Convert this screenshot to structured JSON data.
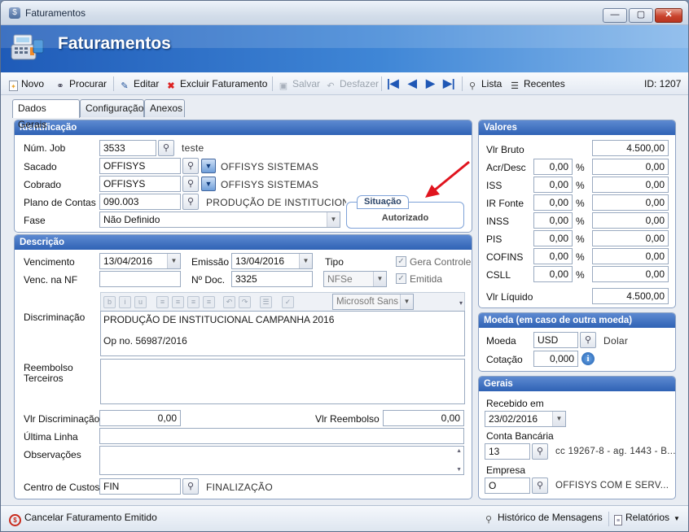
{
  "window": {
    "title": "Faturamentos",
    "banner_title": "Faturamentos"
  },
  "toolbar": {
    "novo": "Novo",
    "procurar": "Procurar",
    "editar": "Editar",
    "excluir": "Excluir Faturamento",
    "salvar": "Salvar",
    "desfazer": "Desfazer",
    "lista": "Lista",
    "recentes": "Recentes",
    "id": "ID: 1207"
  },
  "tabs": [
    {
      "label": "Dados Gerais"
    },
    {
      "label": "Configuração"
    },
    {
      "label": "Anexos"
    }
  ],
  "identificacao": {
    "header": "Identificação",
    "num_job_label": "Núm. Job",
    "num_job": "3533",
    "num_job_desc": "teste",
    "sacado_label": "Sacado",
    "sacado": "OFFISYS",
    "sacado_desc": "OFFISYS SISTEMAS",
    "cobrado_label": "Cobrado",
    "cobrado": "OFFISYS",
    "cobrado_desc": "OFFISYS SISTEMAS",
    "plano_label": "Plano de Contas",
    "plano": "090.003",
    "plano_desc": "PRODUÇÃO DE INSTITUCIONAL",
    "fase_label": "Fase",
    "fase": "Não Definido",
    "situacao_label": "Situação",
    "situacao": "Autorizado"
  },
  "descricao": {
    "header": "Descrição",
    "vencimento_label": "Vencimento",
    "vencimento": "13/04/2016",
    "emissao_label": "Emissão",
    "emissao": "13/04/2016",
    "tipo_label": "Tipo",
    "tipo": "NFSe",
    "gera_controle_label": "Gera Controle",
    "emitida_label": "Emitida",
    "venc_nf_label": "Venc. na NF",
    "ndoc_label": "Nº Doc.",
    "ndoc": "3325",
    "font_name": "Microsoft Sans",
    "discriminacao_label": "Discriminação",
    "discriminacao_line1": "PRODUÇÃO DE INSTITUCIONAL CAMPANHA 2016",
    "discriminacao_line2": "Op no. 56987/2016",
    "reembolso_label_1": "Reembolso",
    "reembolso_label_2": "Terceiros",
    "vlr_discriminacao_label": "Vlr Discriminação",
    "vlr_discriminacao": "0,00",
    "vlr_reembolso_label": "Vlr Reembolso",
    "vlr_reembolso": "0,00",
    "ultima_linha_label": "Última Linha",
    "observacoes_label": "Observações",
    "centro_custos_label": "Centro de Custos",
    "centro_custos": "FIN",
    "centro_custos_desc": "FINALIZAÇÃO"
  },
  "valores": {
    "header": "Valores",
    "vlr_bruto_label": "Vlr Bruto",
    "vlr_bruto": "4.500,00",
    "rows": [
      {
        "label": "Acr/Desc",
        "pct": "0,00",
        "value": "0,00"
      },
      {
        "label": "ISS",
        "pct": "0,00",
        "value": "0,00"
      },
      {
        "label": "IR Fonte",
        "pct": "0,00",
        "value": "0,00"
      },
      {
        "label": "INSS",
        "pct": "0,00",
        "value": "0,00"
      },
      {
        "label": "PIS",
        "pct": "0,00",
        "value": "0,00"
      },
      {
        "label": "COFINS",
        "pct": "0,00",
        "value": "0,00"
      },
      {
        "label": "CSLL",
        "pct": "0,00",
        "value": "0,00"
      }
    ],
    "pct_sign": "%",
    "vlr_liquido_label": "Vlr Líquido",
    "vlr_liquido": "4.500,00"
  },
  "moeda": {
    "header": "Moeda (em caso de outra moeda)",
    "moeda_label": "Moeda",
    "moeda": "USD",
    "moeda_desc": "Dolar",
    "cotacao_label": "Cotação",
    "cotacao": "0,000"
  },
  "gerais": {
    "header": "Gerais",
    "recebido_label": "Recebido em",
    "recebido": "23/02/2016",
    "conta_label": "Conta Bancária",
    "conta": "13",
    "conta_desc": "cc 19267-8 - ag. 1443 - B...",
    "empresa_label": "Empresa",
    "empresa": "O",
    "empresa_desc": "OFFISYS COM  E SERV..."
  },
  "status": {
    "cancelar": "Cancelar Faturamento Emitido",
    "historico": "Histórico de Mensagens",
    "relatorios": "Relatórios"
  },
  "colors": {
    "accent": "#2f62b5",
    "arrow": "#e0141e"
  }
}
